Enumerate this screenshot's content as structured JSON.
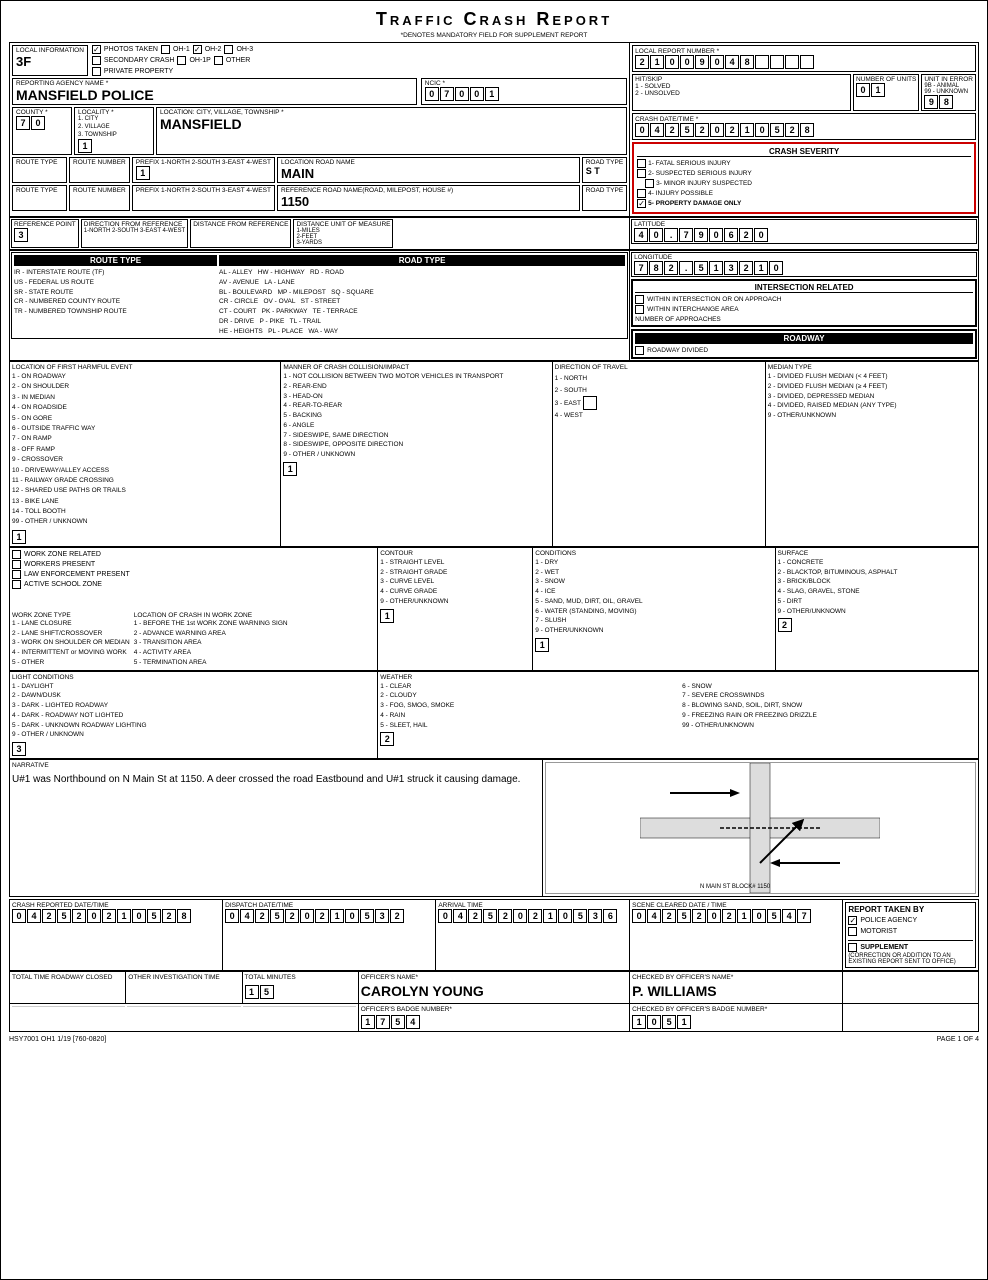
{
  "title": "Traffic Crash Report",
  "subtitle": "*DENOTES MANDATORY FIELD FOR SUPPLEMENT REPORT",
  "localInfo": {
    "label": "LOCAL INFORMATION",
    "value": "3F"
  },
  "localReportNumber": {
    "label": "LOCAL REPORT NUMBER *",
    "digits": [
      "2",
      "1",
      "0",
      "0",
      "9",
      "0",
      "4",
      "8",
      "",
      "",
      "",
      "",
      ""
    ]
  },
  "photosLabel": "PHOTOS TAKEN",
  "oh1Label": "OH-1",
  "oh2Label": "OH-2",
  "oh3Label": "OH-3",
  "secondaryCrash": "SECONDARY CRASH",
  "oh1p": "OH-1P",
  "other": "OTHER",
  "reportingAgency": {
    "label": "REPORTING AGENCY NAME *",
    "value": "MANSFIELD POLICE"
  },
  "ncic": {
    "label": "NCIC *",
    "digits": [
      "0",
      "7",
      "0",
      "0",
      "1"
    ]
  },
  "hitSkip": {
    "label": "HIT/SKIP",
    "opt1": "1 - SOLVED",
    "opt2": "2 - UNSOLVED"
  },
  "numberOfUnits": {
    "label": "NUMBER OF UNITS",
    "digits": [
      "0",
      "1"
    ]
  },
  "unitInError": {
    "label": "UNIT IN ERROR",
    "opt1": "9B - ANIMAL",
    "opt2": "99 - UNKNOWN",
    "digits": [
      "9",
      "8"
    ]
  },
  "privateProperty": "PRIVATE PROPERTY",
  "county": {
    "label": "COUNTY *",
    "digits": [
      "7",
      "0"
    ]
  },
  "locality": {
    "label": "LOCALITY *",
    "opt1": "1. CITY",
    "opt2": "2. VILLAGE",
    "opt3": "3. TOWNSHIP",
    "value": "1"
  },
  "locationCityVillage": {
    "label": "LOCATION: CITY, VILLAGE, TOWNSHIP *",
    "value": "MANSFIELD"
  },
  "crashDateTime": {
    "label": "CRASH DATE/TIME *",
    "digits": [
      "0",
      "4",
      "2",
      "5",
      "2",
      "0",
      "2",
      "1",
      "0",
      "5",
      "2",
      "8"
    ]
  },
  "crashSeverity": {
    "label": "CRASH SEVERITY",
    "items": [
      "1- FATAL SERIOUS INJURY",
      "2- SUSPECTED SERIOUS INJURY",
      "3- MINOR INJURY SUSPECTED",
      "4- INJURY POSSIBLE",
      "5- PROPERTY DAMAGE ONLY"
    ],
    "selected": "5"
  },
  "routeType1": {
    "label": "ROUTE TYPE"
  },
  "routeNumber1": {
    "label": "ROUTE NUMBER"
  },
  "prefix1": {
    "label": "PREFIX 1-NORTH 2-SOUTH 3-EAST 4-WEST",
    "value": "1"
  },
  "locationRoadName": {
    "label": "LOCATION ROAD NAME",
    "value": "MAIN"
  },
  "roadType1": {
    "label": "ROAD TYPE",
    "value": "S T"
  },
  "latitude": {
    "label": "LATITUDE",
    "digits": [
      "4",
      "0",
      ".",
      "7",
      "9",
      "0",
      "6",
      "2",
      "0"
    ]
  },
  "routeType2": {
    "label": "ROUTE TYPE"
  },
  "routeNumber2": {
    "label": "ROUTE NUMBER"
  },
  "prefix2": {
    "label": "PREFIX 1-NORTH 2-SOUTH 3-EAST 4-WEST"
  },
  "referenceRoadName": {
    "label": "REFERENCE ROAD NAME(ROAD, MILEPOST, HOUSE #)",
    "value": "1150"
  },
  "roadType2": {
    "label": "ROAD TYPE"
  },
  "longitude": {
    "label": "LONGITUDE",
    "digits": [
      "7",
      "8",
      "2",
      ".",
      "5",
      "1",
      "3",
      "2",
      "1",
      "0"
    ]
  },
  "referencePoint": {
    "label": "REFERENCE POINT",
    "value": "3"
  },
  "directionFromRef": {
    "label": "DIRECTION FROM REFERENCE",
    "opts": [
      "1-NORTH",
      "2-SOUTH",
      "3-EAST",
      "4-WEST"
    ]
  },
  "distanceFromRef": {
    "label": "DISTANCE FROM REFERENCE"
  },
  "distanceUnitOfMeasure": {
    "label": "DISTANCE UNIT OF MEASURE",
    "opts": [
      "1-MILES",
      "2-FEET",
      "3-YARDS"
    ]
  },
  "routeTypeSection": {
    "label": "ROUTE TYPE",
    "items": [
      "IR - INTERSTATE ROUTE (TF)",
      "US - FEDERAL US ROUTE",
      "SR - STATE ROUTE",
      "CR - NUMBERED COUNTY ROUTE",
      "TR - NUMBERED TOWNSHIP ROUTE"
    ]
  },
  "roadTypeSection": {
    "label": "ROAD TYPE",
    "items": [
      "AL - ALLEY  HW - HIGHWAY  RD - ROAD",
      "AV - AVENUE  LA - LANE",
      "BL - BOULEVARD  MP - MILEPOST  SQ - SQUARE",
      "CR - CIRCLE  OV - OVAL  ST - STREET",
      "CT - COURT  PK - PARKWAY  TE - TERRACE",
      "DR - DRIVE  P - PIKE  TL - TRAIL",
      "HE - HEIGHTS  PL - PLACE  WA - WAY"
    ]
  },
  "intersectionRelated": {
    "label": "INTERSECTION RELATED",
    "items": [
      "WITHIN INTERSECTION OR ON APPROACH",
      "WITHIN INTERCHANGE AREA"
    ],
    "numberOfApproaches": "NUMBER OF APPROACHES"
  },
  "roadway": {
    "label": "ROADWAY",
    "dividedLabel": "ROADWAY DIVIDED"
  },
  "locationFirstHarmfulEvent": {
    "label": "LOCATION OF FIRST HARMFUL EVENT",
    "items": [
      "1 - ON ROADWAY",
      "2 - ON SHOULDER",
      "3 - IN MEDIAN",
      "4 - ON ROADSIDE",
      "5 - ON GORE",
      "6 - OUTSIDE TRAFFIC WAY",
      "7 - ON RAMP",
      "8 - OFF RAMP",
      "9 - CROSSOVER",
      "10 - DRIVEWAY/ALLEY ACCESS",
      "11 - RAILWAY GRADE CROSSING",
      "12 - SHARED USE PATHS OR TRAILS",
      "13 - BIKE LANE",
      "14 - TOLL BOOTH",
      "99 - OTHER / UNKNOWN"
    ],
    "value": "1"
  },
  "mannerOfCrash": {
    "label": "MANNER OF CRASH COLLISION/IMPACT",
    "items": [
      "1 - NOT COLLISION BETWEEN TWO MOTOR VEHICLES IN TRANSPORT",
      "2 - REAR-END",
      "3 - HEAD-ON",
      "4 - REAR-TO-REAR",
      "5 - BACKING",
      "6 - ANGLE",
      "7 - SIDESWIPE, SAME DIRECTION",
      "8 - SIDESWIPE, OPPOSITE DIRECTION",
      "9 - OTHER / UNKNOWN"
    ],
    "value": "1"
  },
  "directionOfTravel": {
    "label": "DIRECTION OF TRAVEL",
    "items": [
      "1 - NORTH",
      "2 - SOUTH",
      "3 - EAST",
      "4 - WEST"
    ]
  },
  "medianType": {
    "label": "MEDIAN TYPE",
    "items": [
      "1 - DIVIDED FLUSH MEDIAN (< 4 FEET)",
      "2 - DIVIDED FLUSH MEDIAN (≥ 4 FEET)",
      "3 - DIVIDED, DEPRESSED MEDIAN",
      "4 - DIVIDED, RAISED MEDIAN (ANY TYPE)",
      "9 - OTHER/UNKNOWN"
    ]
  },
  "workZone": {
    "workZoneRelated": "WORK ZONE RELATED",
    "workersPresent": "WORKERS PRESENT",
    "lawEnforcementPresent": "LAW ENFORCEMENT PRESENT",
    "activeSchoolZone": "ACTIVE SCHOOL ZONE",
    "workZoneType": {
      "label": "WORK ZONE TYPE",
      "items": [
        "1 - LANE CLOSURE",
        "2 - LANE SHIFT/CROSSOVER",
        "3 - WORK ON SHOULDER OR MEDIAN",
        "4 - INTERMITTENT or MOVING WORK",
        "5 - OTHER"
      ]
    },
    "locationInWorkZone": {
      "label": "LOCATION OF CRASH IN WORK ZONE",
      "items": [
        "1 - BEFORE THE 1st WORK ZONE WARNING SIGN",
        "2 - ADVANCE WARNING AREA",
        "3 - TRANSITION AREA",
        "4 - ACTIVITY AREA",
        "5 - TERMINATION AREA"
      ]
    }
  },
  "contour": {
    "label": "CONTOUR",
    "items": [
      "1 - STRAIGHT LEVEL",
      "2 - STRAIGHT GRADE",
      "3 - CURVE LEVEL",
      "4 - CURVE GRADE",
      "9 - OTHER/UNKNOWN"
    ],
    "value": "1"
  },
  "conditions": {
    "label": "CONDITIONS",
    "items": [
      "1 - DRY",
      "2 - WET",
      "3 - SNOW",
      "4 - ICE",
      "5 - SAND, MUD, DIRT, OIL, GRAVEL",
      "6 - WATER (STANDING, MOVING)",
      "7 - SLUSH",
      "9 - OTHER/UNKNOWN"
    ],
    "value": "1"
  },
  "surface": {
    "label": "SURFACE",
    "items": [
      "1 - CONCRETE",
      "2 - BLACKTOP, BITUMINOUS, ASPHALT",
      "3 - BRICK/BLOCK",
      "4 - SLAG, GRAVEL, STONE",
      "5 - DIRT",
      "9 - OTHER/UNKNOWN"
    ],
    "value": "2"
  },
  "lightConditions": {
    "label": "LIGHT CONDITIONS",
    "items": [
      "1 - DAYLIGHT",
      "2 - DAWN/DUSK",
      "3 - DARK - LIGHTED ROADWAY",
      "4 - DARK - ROADWAY NOT LIGHTED",
      "5 - DARK - UNKNOWN ROADWAY LIGHTING",
      "9 - OTHER / UNKNOWN"
    ],
    "value": "3"
  },
  "weather": {
    "label": "WEATHER",
    "items": [
      "1 - CLEAR",
      "2 - CLOUDY",
      "3 - FOG, SMOG, SMOKE",
      "4 - RAIN",
      "5 - SLEET, HAIL",
      "6 - SNOW",
      "7 - SEVERE CROSSWINDS",
      "8 - BLOWING SAND, SOIL, DIRT, SNOW",
      "9 - FREEZING RAIN OR FREEZING DRIZZLE",
      "99 - OTHER/UNKNOWN"
    ],
    "value": "2"
  },
  "narrative": {
    "label": "NARRATIVE",
    "text": "U#1 was Northbound on N Main St at 1150.  A deer crossed\nthe road Eastbound and U#1 struck it causing damage."
  },
  "crashReportedDateTime": {
    "label": "CRASH REPORTED DATE/TIME",
    "digits": [
      "0",
      "4",
      "2",
      "5",
      "2",
      "0",
      "2",
      "1",
      "0",
      "5",
      "2",
      "8"
    ]
  },
  "dispatchDateTime": {
    "label": "DISPATCH DATE/TIME",
    "digits": [
      "0",
      "4",
      "2",
      "5",
      "2",
      "0",
      "2",
      "1",
      "0",
      "5",
      "3",
      "2"
    ]
  },
  "arrivalTime": {
    "label": "ARRIVAL TIME",
    "digits": [
      "0",
      "4",
      "2",
      "5",
      "2",
      "0",
      "2",
      "1",
      "0",
      "5",
      "3",
      "6"
    ]
  },
  "sceneClearedDateTime": {
    "label": "SCENE CLEARED DATE / TIME",
    "digits": [
      "0",
      "4",
      "2",
      "5",
      "2",
      "0",
      "2",
      "1",
      "0",
      "5",
      "4",
      "7"
    ]
  },
  "reportTakenBy": {
    "label": "REPORT TAKEN BY",
    "policeAgency": "POLICE AGENCY",
    "motorist": "MOTORIST",
    "supplement": "SUPPLEMENT",
    "supplementDesc": "(CORRECTION OR ADDITION TO AN EXISTING REPORT SENT TO OFFICE)"
  },
  "totalTimeRoadwayClosed": {
    "label": "TOTAL TIME ROADWAY CLOSED"
  },
  "otherInvestigationTime": {
    "label": "OTHER INVESTIGATION TIME"
  },
  "totalMinutes": {
    "label": "TOTAL MINUTES",
    "digits": [
      "1",
      "5"
    ]
  },
  "officerName": {
    "label": "OFFICER'S NAME*",
    "value": "CAROLYN YOUNG"
  },
  "checkedByOfficerName": {
    "label": "CHECKED BY OFFICER'S NAME*",
    "value": "P. WILLIAMS"
  },
  "officerBadgeNumber": {
    "label": "OFFICER'S BADGE NUMBER*",
    "digits": [
      "1",
      "7",
      "5",
      "4"
    ]
  },
  "checkedByBadgeNumber": {
    "label": "CHECKED BY OFFICER'S BADGE NUMBER*",
    "digits": [
      "1",
      "0",
      "5",
      "1"
    ]
  },
  "footer": {
    "formNumber": "HSY7001 OH1 1/19 [760-0820]",
    "page": "PAGE",
    "pageNum": "1",
    "of": "OF",
    "totalPages": "4"
  }
}
